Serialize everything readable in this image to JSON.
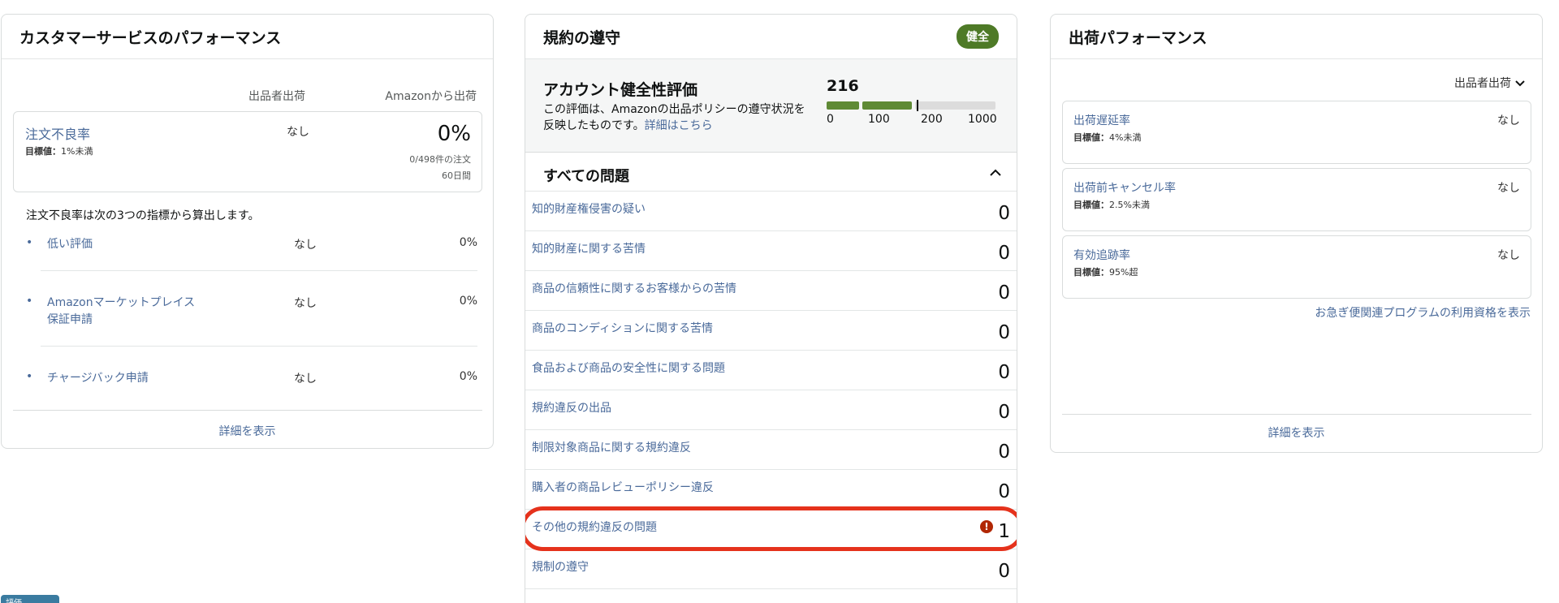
{
  "customer_service": {
    "title": "カスタマーサービスのパフォーマンス",
    "col_seller": "出品者出荷",
    "col_amazon": "Amazonから出荷",
    "odr": {
      "label": "注文不良率",
      "target_label": "目標値：",
      "target_value": "1%未満",
      "seller": "なし",
      "value": "0%",
      "sub1": "0/498件の注文",
      "sub2": "60日間"
    },
    "note": "注文不良率は次の3つの指標から算出します。",
    "metrics": [
      {
        "bullet": "•",
        "label": "低い評価",
        "seller": "なし",
        "value": "0%"
      },
      {
        "bullet": "•",
        "label": "Amazonマーケットプレイス",
        "label2": "保証申請",
        "seller": "なし",
        "value": "0%"
      },
      {
        "bullet": "•",
        "label": "チャージバック申請",
        "seller": "なし",
        "value": "0%"
      }
    ],
    "footer": "詳細を表示"
  },
  "policy_compliance": {
    "title": "規約の遵守",
    "badge": "健全",
    "badge_color": "#4e7a27",
    "health": {
      "title": "アカウント健全性評価",
      "desc": "この評価は、Amazonの出品ポリシーの遵守状況を反映したものです。",
      "desc_link": "詳細はこちら",
      "score": "216",
      "ticks": [
        "0",
        "100",
        "200",
        "1000"
      ]
    },
    "issues_title": "すべての問題",
    "issues": [
      {
        "label": "知的財産権侵害の疑い",
        "count": "0"
      },
      {
        "label": "知的財産に関する苦情",
        "count": "0"
      },
      {
        "label": "商品の信頼性に関するお客様からの苦情",
        "count": "0"
      },
      {
        "label": "商品のコンディションに関する苦情",
        "count": "0"
      },
      {
        "label": "食品および商品の安全性に関する問題",
        "count": "0"
      },
      {
        "label": "規約違反の出品",
        "count": "0"
      },
      {
        "label": "制限対象商品に関する規約違反",
        "count": "0"
      },
      {
        "label": "購入者の商品レビューポリシー違反",
        "count": "0"
      },
      {
        "label": "その他の規約違反の問題",
        "count": "1",
        "alert": "!"
      },
      {
        "label": "規制の遵守",
        "count": "0"
      }
    ]
  },
  "shipping_performance": {
    "title": "出荷パフォーマンス",
    "filter": "出品者出荷",
    "metrics": [
      {
        "label": "出荷遅延率",
        "target_label": "目標値：",
        "target_value": "4%未満",
        "value": "なし"
      },
      {
        "label": "出荷前キャンセル率",
        "target_label": "目標値：",
        "target_value": "2.5%未満",
        "value": "なし"
      },
      {
        "label": "有効追跡率",
        "target_label": "目標値：",
        "target_value": "95%超",
        "value": "なし"
      }
    ],
    "link": "お急ぎ便関連プログラムの利用資格を表示",
    "footer": "詳細を表示"
  },
  "bottom_pill": "評価 ⌄",
  "colors": {
    "link": "#4a6a9a",
    "highlight": "#e5321c",
    "alert": "#b12704"
  }
}
